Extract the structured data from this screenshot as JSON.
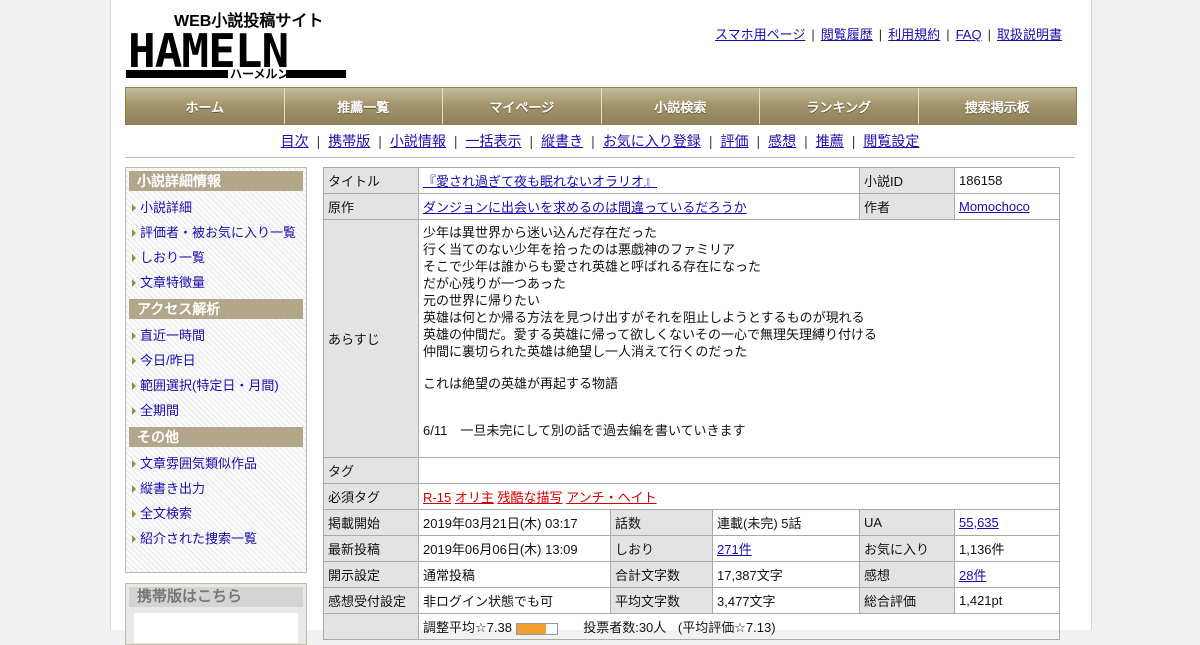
{
  "header": {
    "logo": {
      "text_main": "HAMELN",
      "text_sub": "WEB小説投稿サイト",
      "text_kana": "ハーメルン"
    },
    "top_links": [
      "スマホ用ページ",
      "閲覧履歴",
      "利用規約",
      "FAQ",
      "取扱説明書"
    ]
  },
  "main_nav": [
    "ホーム",
    "推薦一覧",
    "マイページ",
    "小説検索",
    "ランキング",
    "捜索掲示板"
  ],
  "sub_nav": [
    "目次",
    "携帯版",
    "小説情報",
    "一括表示",
    "縦書き",
    "お気に入り登録",
    "評価",
    "感想",
    "推薦",
    "閲覧設定"
  ],
  "sidebar": {
    "sections": [
      {
        "heading": "小説詳細情報",
        "items": [
          "小説詳細",
          "評価者・被お気に入り一覧",
          "しおり一覧",
          "文章特徴量"
        ]
      },
      {
        "heading": "アクセス解析",
        "items": [
          "直近一時間",
          "今日/昨日",
          "範囲選択(特定日・月間)",
          "全期間"
        ]
      },
      {
        "heading": "その他",
        "items": [
          "文章雰囲気類似作品",
          "縦書き出力",
          "全文検索",
          "紹介された捜索一覧"
        ]
      }
    ],
    "mobile_heading": "携帯版はこちら"
  },
  "info": {
    "title_label": "タイトル",
    "title": "『愛され過ぎて夜も眠れないオラリオ』",
    "id_label": "小説ID",
    "id": "186158",
    "original_label": "原作",
    "original": "ダンジョンに出会いを求めるのは間違っているだろうか",
    "author_label": "作者",
    "author": "Momochoco",
    "synopsis_label": "あらすじ",
    "synopsis_lines": [
      "少年は異世界から迷い込んだ存在だった",
      "行く当てのない少年を拾ったのは悪戯神のファミリア",
      "そこで少年は誰からも愛され英雄と呼ばれる存在になった",
      "だが心残りが一つあった",
      "元の世界に帰りたい",
      "英雄は何とか帰る方法を見つけ出すがそれを阻止しようとするものが現れる",
      "英雄の仲間だ。愛する英雄に帰って欲しくないその一心で無理矢理縛り付ける",
      "仲間に裏切られた英雄は絶望し一人消えて行くのだった"
    ],
    "synopsis_line2": "これは絶望の英雄が再起する物語",
    "synopsis_line3": "6/11　一旦未完にして別の話で過去編を書いていきます",
    "tags_label": "タグ",
    "tags": "",
    "required_tags_label": "必須タグ",
    "required_tags": [
      "R-15",
      "オリ主",
      "残酷な描写",
      "アンチ・ヘイト"
    ],
    "rows": [
      {
        "l1": "掲載開始",
        "v1": "2019年03月21日(木) 03:17",
        "l2": "話数",
        "v2": "連載(未完) 5話",
        "l3": "UA",
        "v3": "55,635"
      },
      {
        "l1": "最新投稿",
        "v1": "2019年06月06日(木) 13:09",
        "l2": "しおり",
        "v2": "271件",
        "l3": "お気に入り",
        "v3": "1,136件"
      },
      {
        "l1": "開示設定",
        "v1": "通常投稿",
        "l2": "合計文字数",
        "v2": "17,387文字",
        "l3": "感想",
        "v3": "28件"
      },
      {
        "l1": "感想受付設定",
        "v1": "非ログイン状態でも可",
        "l2": "平均文字数",
        "v2": "3,477文字",
        "l3": "総合評価",
        "v3": "1,421pt"
      }
    ],
    "rating_avg": "調整平均☆7.38",
    "rating_fill": 0.738,
    "rating_votes": "投票者数:30人",
    "rating_plain": "(平均評価☆7.13)"
  }
}
